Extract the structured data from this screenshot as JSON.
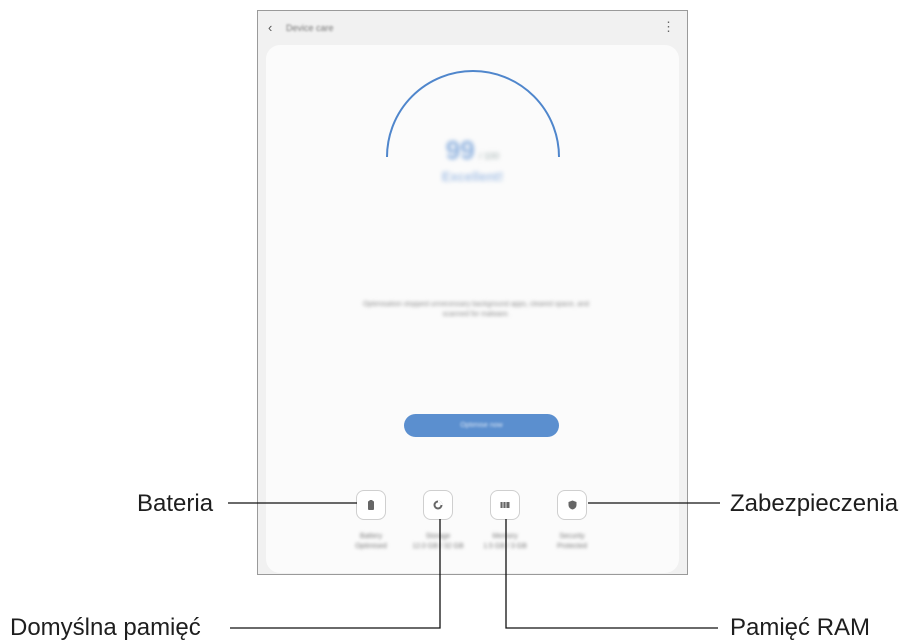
{
  "app": {
    "title": "Device care",
    "back_icon": "chevron-left-icon",
    "more_icon": "more-vertical-icon"
  },
  "score": {
    "value": "99",
    "max_label": "/ 100",
    "status": "Excellent!"
  },
  "description": "Optimisation stopped unnecessary background apps, cleared space, and scanned for malware.",
  "optimize_button": {
    "label": "Optimise now"
  },
  "tiles": [
    {
      "icon": "battery-icon",
      "label": "Battery",
      "sub": "Optimised"
    },
    {
      "icon": "storage-icon",
      "label": "Storage",
      "sub": "12.0 GB / 32 GB"
    },
    {
      "icon": "memory-icon",
      "label": "Memory",
      "sub": "1.5 GB / 3 GB"
    },
    {
      "icon": "shield-icon",
      "label": "Security",
      "sub": "Protected"
    }
  ],
  "callouts": {
    "battery": "Bateria",
    "storage": "Domyślna pamięć",
    "memory": "Pamięć RAM",
    "security": "Zabezpieczenia"
  },
  "colors": {
    "accent": "#5b8fcf",
    "gauge": "#4f86cc",
    "frame": "#9a9a9a"
  }
}
